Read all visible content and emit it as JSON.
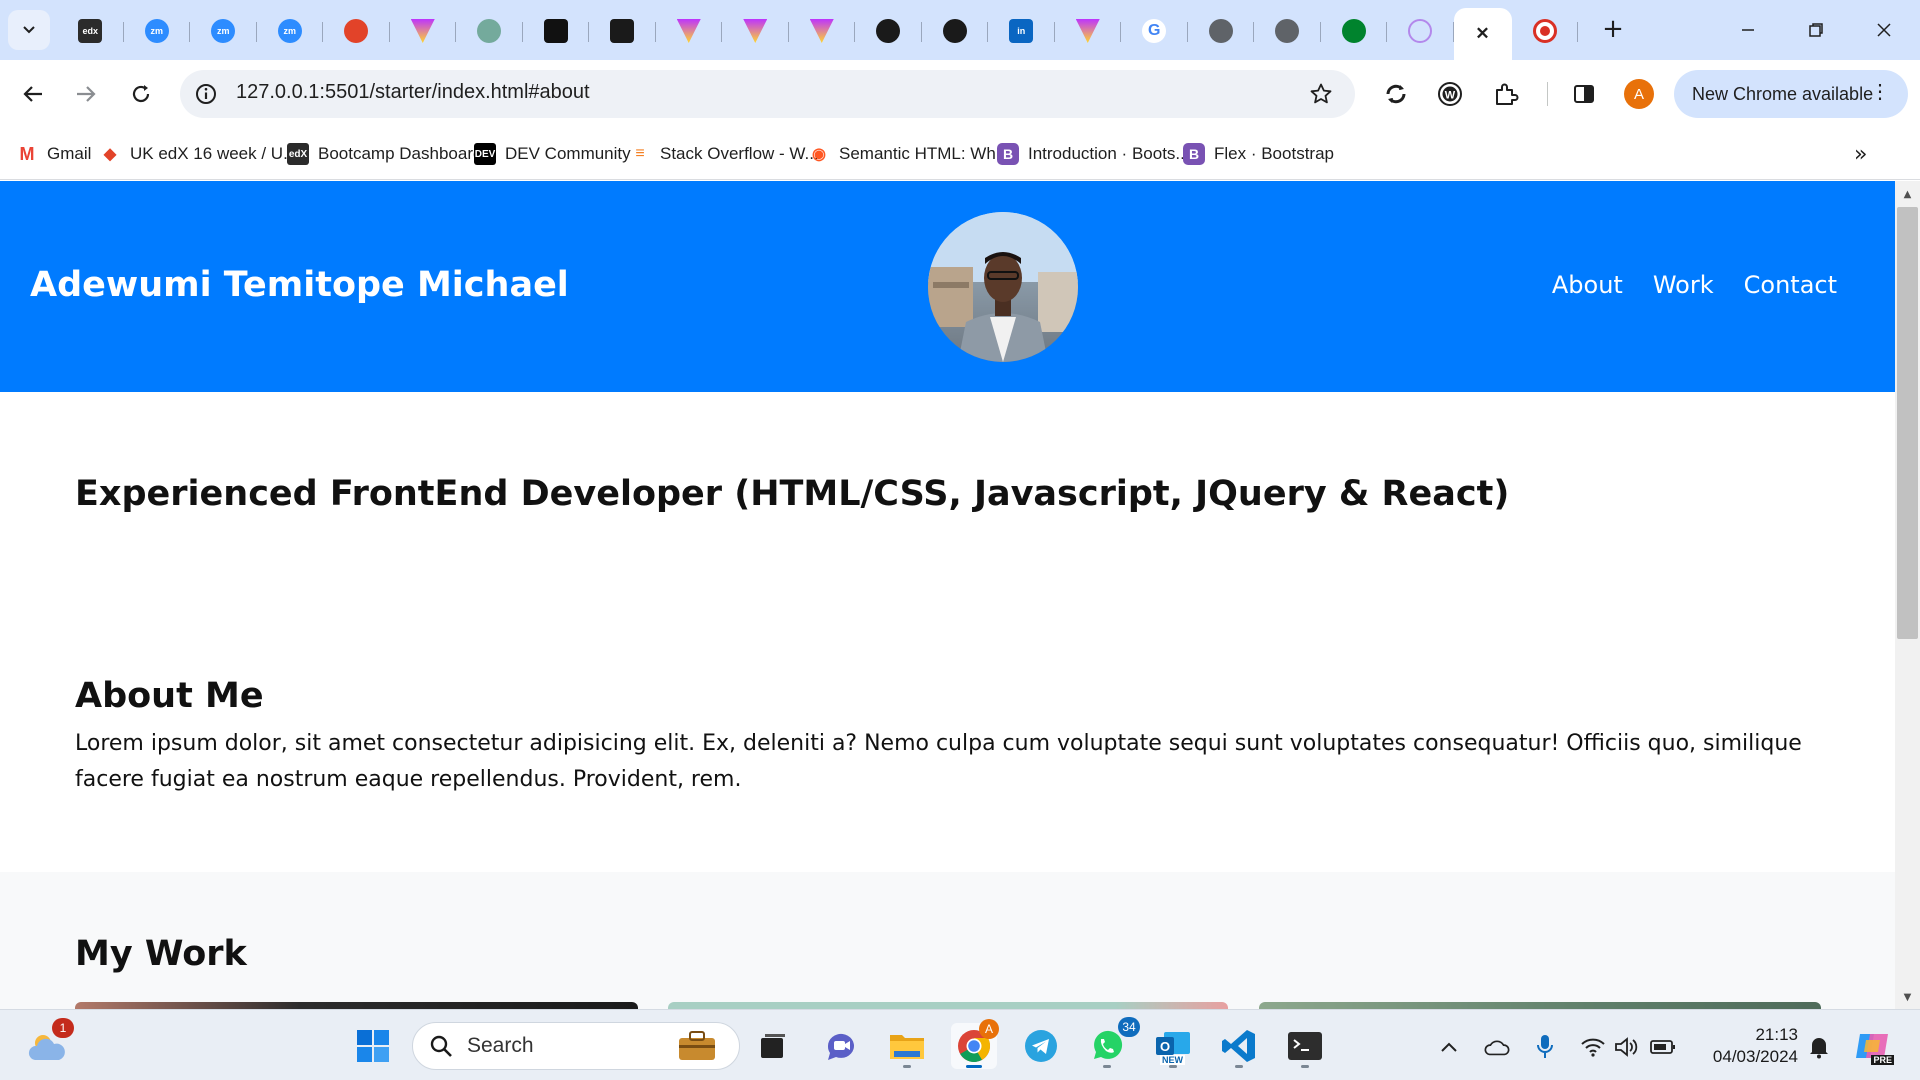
{
  "browser": {
    "tabs": [
      {
        "icon": "edx-icon",
        "label": "edx"
      },
      {
        "icon": "zoom-icon",
        "label": "zm"
      },
      {
        "icon": "zoom-icon",
        "label": "zm"
      },
      {
        "icon": "zoom-icon",
        "label": "zm"
      },
      {
        "icon": "gitlab-icon",
        "label": ""
      },
      {
        "icon": "vite-icon",
        "label": ""
      },
      {
        "icon": "chatgpt-icon",
        "label": ""
      },
      {
        "icon": "chatgpt-dark-icon",
        "label": ""
      },
      {
        "icon": "terminal-icon",
        "label": ""
      },
      {
        "icon": "vite-icon",
        "label": ""
      },
      {
        "icon": "vite-icon",
        "label": ""
      },
      {
        "icon": "vite-icon",
        "label": ""
      },
      {
        "icon": "github-icon",
        "label": ""
      },
      {
        "icon": "github-icon",
        "label": ""
      },
      {
        "icon": "linkedin-icon",
        "label": "in"
      },
      {
        "icon": "vite-icon",
        "label": ""
      },
      {
        "icon": "google-icon",
        "label": "G"
      },
      {
        "icon": "globe-icon",
        "label": ""
      },
      {
        "icon": "globe-icon",
        "label": ""
      },
      {
        "icon": "meet-icon",
        "label": ""
      },
      {
        "icon": "cloud-icon",
        "label": ""
      },
      {
        "icon": "close-icon",
        "label": "✕",
        "active": true
      },
      {
        "icon": "record-icon",
        "label": ""
      }
    ],
    "address": "127.0.0.1:5501/starter/index.html#about",
    "profile_initial": "A",
    "update_label": "New Chrome available",
    "bookmarks": [
      {
        "label": "Gmail",
        "icon": "gmail-icon",
        "color": "#ea4335",
        "glyph": "M"
      },
      {
        "label": "UK edX 16 week / U...",
        "icon": "gitlab-icon",
        "color": "#e24329",
        "glyph": "◆"
      },
      {
        "label": "Bootcamp Dashboard",
        "icon": "edx-icon",
        "color": "#2b2b2b",
        "glyph": "edX"
      },
      {
        "label": "DEV Community",
        "icon": "dev-icon",
        "color": "#000000",
        "glyph": "DEV"
      },
      {
        "label": "Stack Overflow - W...",
        "icon": "stackoverflow-icon",
        "color": "#f48024",
        "glyph": "≡"
      },
      {
        "label": "Semantic HTML: Wh...",
        "icon": "codecademy-icon",
        "color": "#ff5722",
        "glyph": "◉"
      },
      {
        "label": "Introduction · Boots...",
        "icon": "bootstrap-icon",
        "color": "#7952b3",
        "glyph": "B"
      },
      {
        "label": "Flex · Bootstrap",
        "icon": "bootstrap-icon",
        "color": "#7952b3",
        "glyph": "B"
      }
    ]
  },
  "page": {
    "site_title": "Adewumi Temitope Michael",
    "nav": [
      "About",
      "Work",
      "Contact"
    ],
    "headline": "Experienced FrontEnd Developer (HTML/CSS, Javascript, JQuery & React)",
    "about": {
      "title": "About Me",
      "text": "Lorem ipsum dolor, sit amet consectetur adipisicing elit. Ex, deleniti a? Nemo culpa cum voluptate sequi sunt voluptates consequatur! Officiis quo, similique facere fugiat ea nostrum eaque repellendus. Provident, rem."
    },
    "work": {
      "title": "My Work"
    },
    "colors": {
      "header_bg": "#007bff",
      "work_bg": "#f8f9fa"
    }
  },
  "taskbar": {
    "weather_badge": "1",
    "search_placeholder": "Search",
    "whatsapp_badge": "34",
    "chrome_badge": "A",
    "outlook_label": "NEW",
    "copilot_label": "PRE",
    "time": "21:13",
    "date": "04/03/2024"
  }
}
